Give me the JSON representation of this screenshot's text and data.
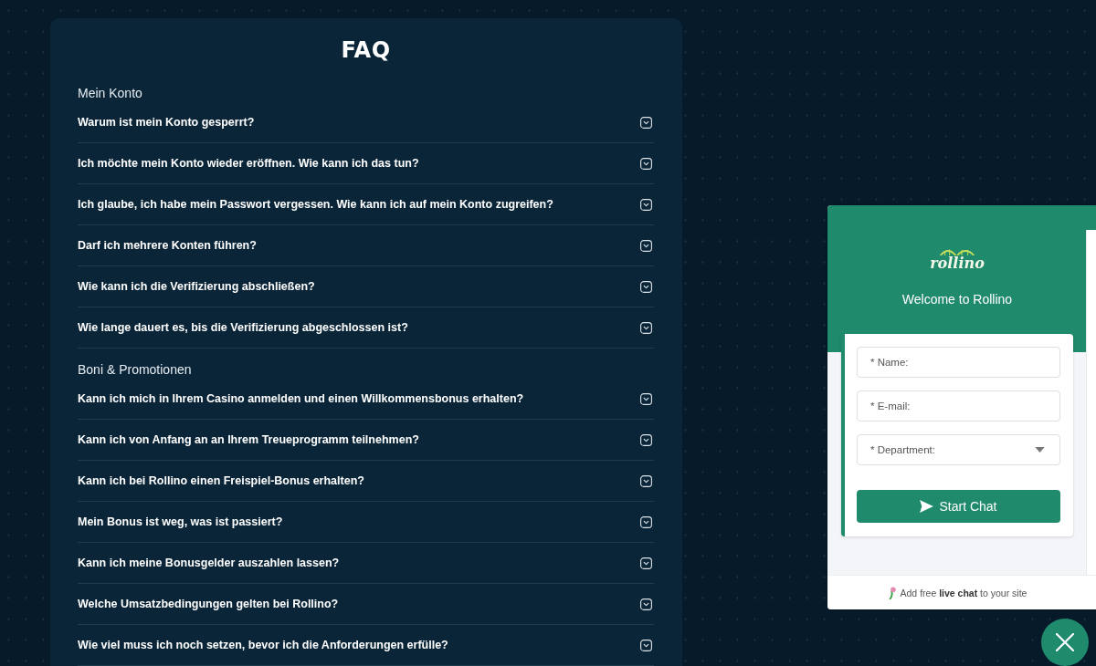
{
  "faq": {
    "title": "FAQ",
    "sections": [
      {
        "heading": "Mein Konto",
        "questions": [
          "Warum ist mein Konto gesperrt?",
          "Ich möchte mein Konto wieder eröffnen. Wie kann ich das tun?",
          "Ich glaube, ich habe mein Passwort vergessen. Wie kann ich auf mein Konto zugreifen?",
          "Darf ich mehrere Konten führen?",
          "Wie kann ich die Verifizierung abschließen?",
          "Wie lange dauert es, bis die Verifizierung abgeschlossen ist?"
        ]
      },
      {
        "heading": "Boni & Promotionen",
        "questions": [
          "Kann ich mich in Ihrem Casino anmelden und einen Willkommensbonus erhalten?",
          "Kann ich von Anfang an an Ihrem Treueprogramm teilnehmen?",
          "Kann ich bei Rollino einen Freispiel-Bonus erhalten?",
          "Mein Bonus ist weg, was ist passiert?",
          "Kann ich meine Bonusgelder auszahlen lassen?",
          "Welche Umsatzbedingungen gelten bei Rollino?",
          "Wie viel muss ich noch setzen, bevor ich die Anforderungen erfülle?"
        ]
      }
    ]
  },
  "chat_widget": {
    "logo": "rollino",
    "welcome": "Welcome to Rollino",
    "fields": [
      {
        "kind": "text",
        "placeholder": "* Name:"
      },
      {
        "kind": "text",
        "placeholder": "* E-mail:"
      },
      {
        "kind": "select",
        "placeholder": "* Department:"
      }
    ],
    "start_button": "Start Chat",
    "footer": "Add free **live chat** to your site"
  }
}
